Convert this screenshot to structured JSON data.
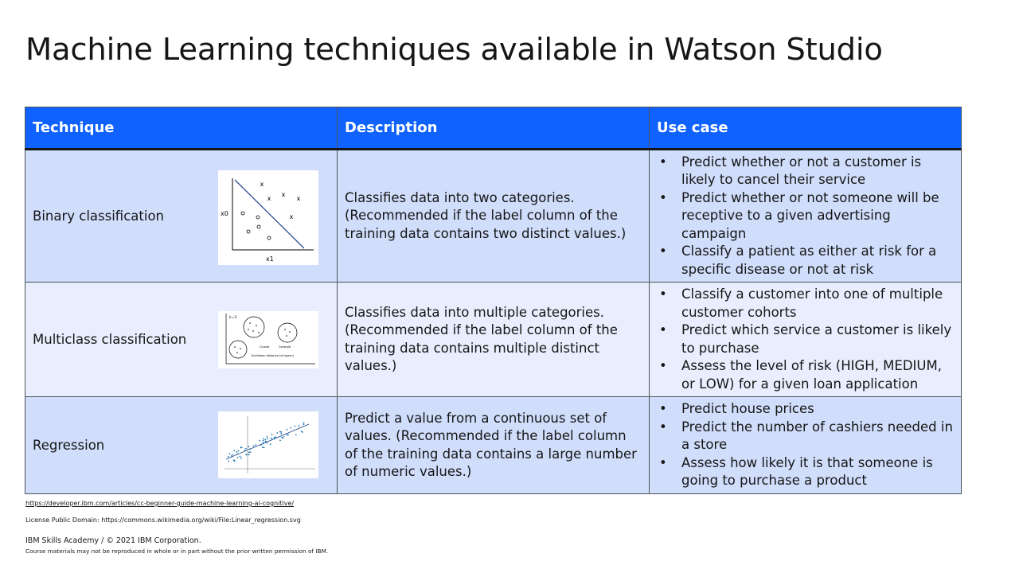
{
  "slide": {
    "title": "Machine Learning techniques available in Watson Studio"
  },
  "table": {
    "headers": [
      "Technique",
      "Description",
      "Use case"
    ],
    "rows": [
      {
        "technique": "Binary classification",
        "description": "Classifies data into two categories. (Recommended if the label column of the training data contains two distinct values.)",
        "use_cases": [
          "Predict whether or not a customer is likely to cancel their service",
          "Predict whether or not someone will be receptive to a given advertising campaign",
          "Classify a patient as either at risk for a specific disease or not at risk"
        ],
        "thumbnail_labels": {
          "x_axis": "x1",
          "y_axis": "x0"
        }
      },
      {
        "technique": "Multiclass classification",
        "description": "Classifies data into multiple categories. (Recommended if the label column of the training data contains multiple distinct values.)",
        "use_cases": [
          "Classify a customer into one of multiple customer cohorts",
          "Predict which service a customer is likely to purchase",
          "Assess the level of risk (HIGH, MEDIUM, or LOW) for a given loan application"
        ],
        "thumbnail_labels": {
          "k": "k=3",
          "cluster": "Cluster",
          "centroid": "Centroid",
          "distance": "Euclidean distance (of space)"
        }
      },
      {
        "technique": "Regression",
        "description": "Predict a value from a continuous set of values. (Recommended if the label column of the training data contains a large number of numeric values.)",
        "use_cases": [
          "Predict house prices",
          "Predict the number of cashiers needed in a store",
          "Assess how likely it is that someone is going to purchase a product"
        ]
      }
    ]
  },
  "footer": {
    "source_link": "https://developer.ibm.com/articles/cc-beginner-guide-machine-learning-ai-cognitive/",
    "license": "License Public Domain: https://commons.wikimedia.org/wiki/File:Linear_regression.svg",
    "copyright": "IBM Skills Academy / © 2021 IBM Corporation.",
    "rights": "Course materials may not be reproduced in whole or in part without the prior written permission of IBM."
  },
  "colors": {
    "header_bg": "#0f62fe",
    "row_dark": "#d0ddfb",
    "row_light": "#e8eefd"
  }
}
